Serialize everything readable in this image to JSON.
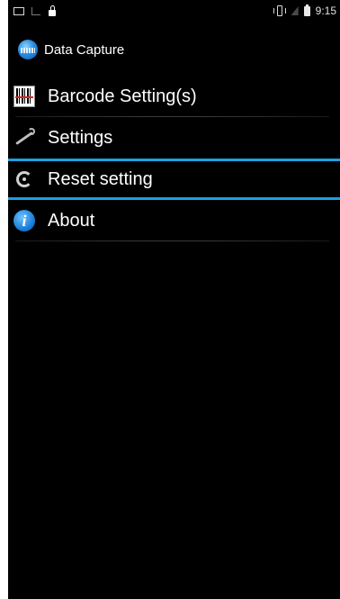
{
  "status_bar": {
    "time": "9:15",
    "icons_left": [
      "screen-icon",
      "signal-icon",
      "lock-icon"
    ],
    "icons_right": [
      "vibrate-icon",
      "wifi-icon",
      "battery-icon"
    ]
  },
  "app_bar": {
    "title": "Data Capture",
    "logo": "app-logo-icon"
  },
  "menu": {
    "items": [
      {
        "label": "Barcode Setting(s)",
        "icon": "barcode-icon",
        "selected": false
      },
      {
        "label": "Settings",
        "icon": "wrench-icon",
        "selected": false
      },
      {
        "label": "Reset setting",
        "icon": "reset-icon",
        "selected": true
      },
      {
        "label": "About",
        "icon": "info-icon",
        "selected": false
      }
    ]
  },
  "colors": {
    "background": "#000000",
    "selection_border": "#1ba0e2",
    "text": "#ffffff"
  }
}
